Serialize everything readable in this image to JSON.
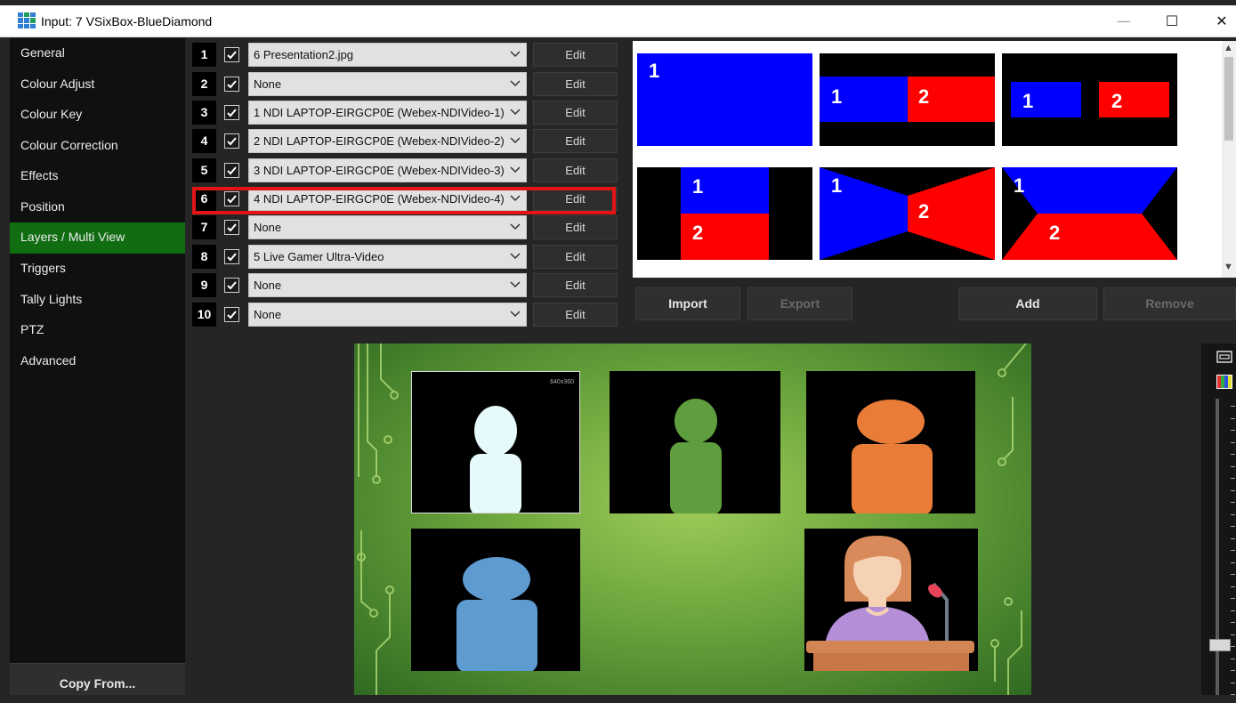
{
  "window": {
    "title": "Input: 7 VSixBox-BlueDiamond",
    "minimize_glyph": "—",
    "maximize_glyph": "☐",
    "close_glyph": "✕"
  },
  "sidebar": {
    "items": [
      {
        "label": "General",
        "active": false
      },
      {
        "label": "Colour Adjust",
        "active": false
      },
      {
        "label": "Colour Key",
        "active": false
      },
      {
        "label": "Colour Correction",
        "active": false
      },
      {
        "label": "Effects",
        "active": false
      },
      {
        "label": "Position",
        "active": false
      },
      {
        "label": "Layers / Multi View",
        "active": true
      },
      {
        "label": "Triggers",
        "active": false
      },
      {
        "label": "Tally Lights",
        "active": false
      },
      {
        "label": "PTZ",
        "active": false
      },
      {
        "label": "Advanced",
        "active": false
      }
    ],
    "copy_from_label": "Copy From..."
  },
  "layers": [
    {
      "number": "1",
      "checked": true,
      "source": "6 Presentation2.jpg",
      "edit_label": "Edit"
    },
    {
      "number": "2",
      "checked": true,
      "source": "None",
      "edit_label": "Edit"
    },
    {
      "number": "3",
      "checked": true,
      "source": "1 NDI LAPTOP-EIRGCP0E (Webex-NDIVideo-1)",
      "edit_label": "Edit"
    },
    {
      "number": "4",
      "checked": true,
      "source": "2 NDI LAPTOP-EIRGCP0E (Webex-NDIVideo-2)",
      "edit_label": "Edit"
    },
    {
      "number": "5",
      "checked": true,
      "source": "3 NDI LAPTOP-EIRGCP0E (Webex-NDIVideo-3)",
      "edit_label": "Edit"
    },
    {
      "number": "6",
      "checked": true,
      "source": "4 NDI LAPTOP-EIRGCP0E (Webex-NDIVideo-4)",
      "edit_label": "Edit",
      "highlighted": true
    },
    {
      "number": "7",
      "checked": true,
      "source": "None",
      "edit_label": "Edit"
    },
    {
      "number": "8",
      "checked": true,
      "source": "5 Live Gamer Ultra-Video",
      "edit_label": "Edit"
    },
    {
      "number": "9",
      "checked": true,
      "source": "None",
      "edit_label": "Edit"
    },
    {
      "number": "10",
      "checked": true,
      "source": "None",
      "edit_label": "Edit"
    }
  ],
  "presets": {
    "label_1": "1",
    "label_2": "2",
    "colors": {
      "one": "#0000ff",
      "two": "#ff0000",
      "background": "#000000"
    },
    "import_label": "Import",
    "export_label": "Export",
    "add_label": "Add",
    "remove_label": "Remove",
    "export_enabled": false,
    "remove_enabled": false
  },
  "preview": {
    "resolution_label": "640x360",
    "background": "green-circuit",
    "avatar_colors": [
      "#e6f9fb",
      "#5f9e3e",
      "#e97d38",
      "#5e9bd1"
    ]
  },
  "side_tools": {
    "icons": [
      "frame-icon",
      "color-bars-icon"
    ]
  }
}
